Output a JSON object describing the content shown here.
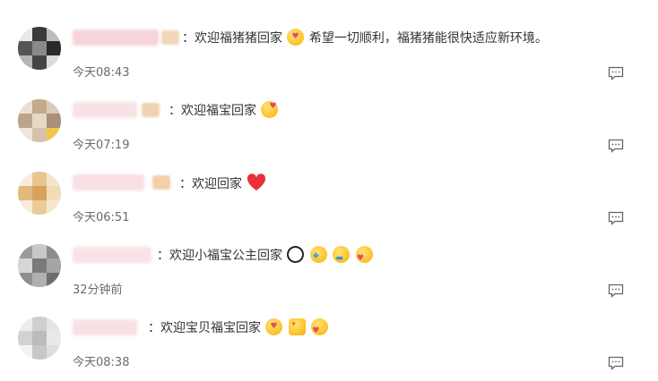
{
  "comments": [
    {
      "text_prefix": "：欢迎福猪猪回家",
      "text_suffix": "希望一切顺利，福猪猪能很快适应新环境。",
      "time": "今天08:43",
      "emojis": [
        "kiss-face-emoji"
      ]
    },
    {
      "text_prefix": "：欢迎福宝回家",
      "text_suffix": "",
      "time": "今天07:19",
      "emojis": [
        "tongue-kiss-emoji"
      ]
    },
    {
      "text_prefix": "：欢迎回家",
      "text_suffix": "",
      "time": "今天06:51",
      "emojis": [
        "red-heart-emoji"
      ]
    },
    {
      "text_prefix": "：欢迎小福宝公主回家",
      "text_suffix": "",
      "time": "32分钟前",
      "emojis": [
        "panda-emoji",
        "sob-face-emoji",
        "hug-emoji",
        "love-kiss-emoji"
      ]
    },
    {
      "text_prefix": "：欢迎宝贝福宝回家",
      "text_suffix": "",
      "time": "今天08:38",
      "emojis": [
        "kiss-face-emoji",
        "cheer-emoji",
        "love-kiss-emoji"
      ]
    }
  ]
}
